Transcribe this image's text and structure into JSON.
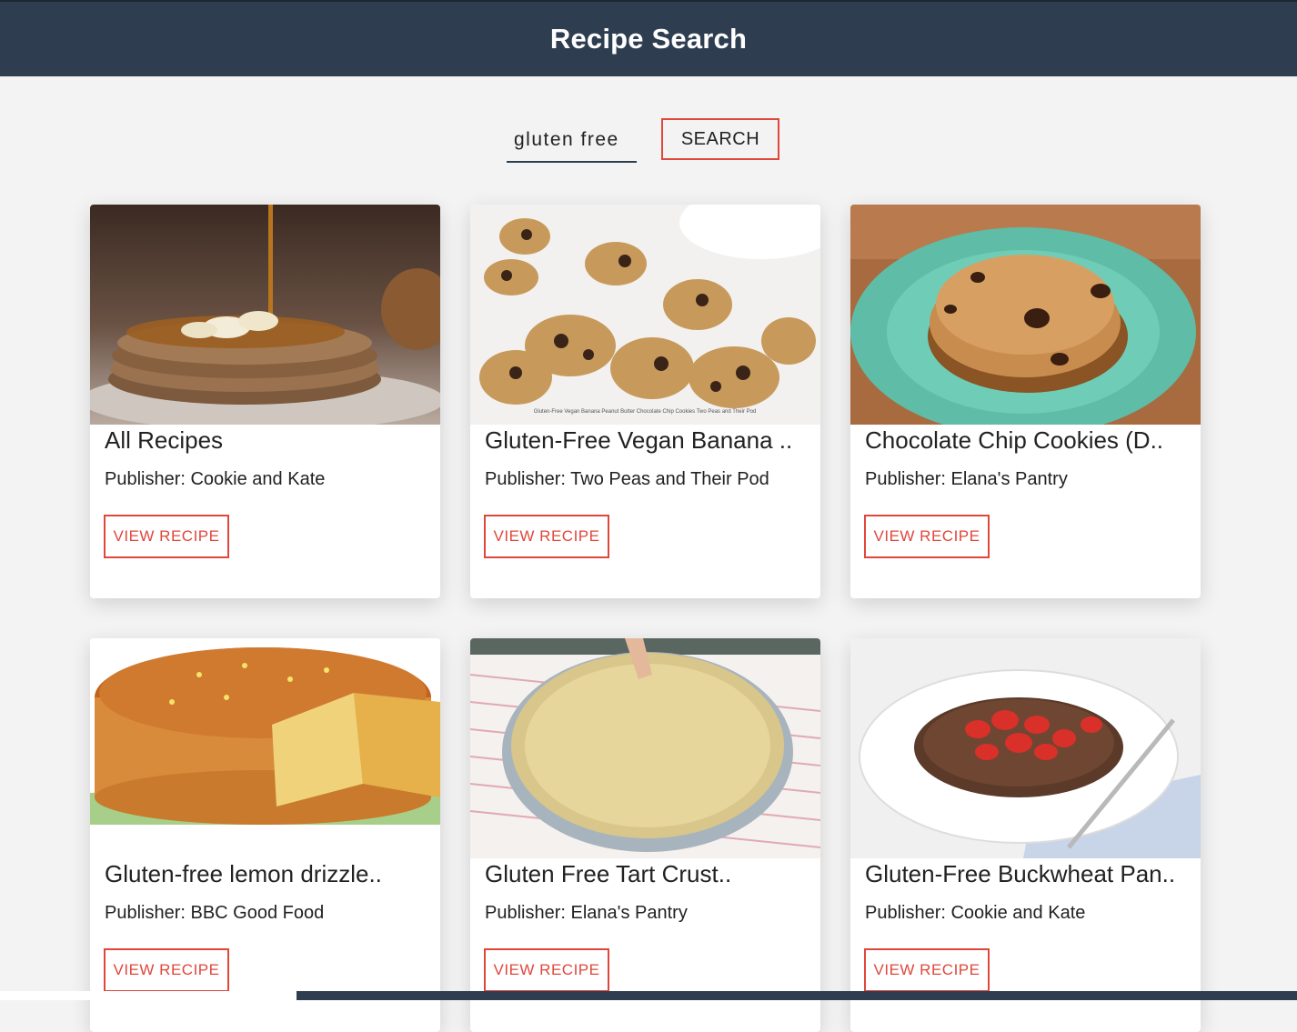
{
  "header": {
    "title": "Recipe Search"
  },
  "search": {
    "value": "gluten free",
    "button_label": "SEARCH"
  },
  "recipes": [
    {
      "title": "All Recipes",
      "publisher": "Publisher: Cookie and Kate",
      "button_label": "VIEW RECIPE",
      "image": "pancakes-with-banana-and-syrup"
    },
    {
      "title": "Gluten-Free Vegan Banana ..",
      "publisher": "Publisher: Two Peas and Their Pod",
      "button_label": "VIEW RECIPE",
      "image": "banana-oat-cookies",
      "image_caption": "Gluten-Free Vegan Banana Peanut Butter Chocolate Chip Cookies Two Peas and Their Pod"
    },
    {
      "title": "Chocolate Chip Cookies (D..",
      "publisher": "Publisher: Elana's Pantry",
      "button_label": "VIEW RECIPE",
      "image": "cookies-on-teal-plate"
    },
    {
      "title": "Gluten-free lemon drizzle..",
      "publisher": "Publisher: BBC Good Food",
      "button_label": "VIEW RECIPE",
      "image": "lemon-drizzle-cake"
    },
    {
      "title": "Gluten Free Tart Crust..",
      "publisher": "Publisher: Elana's Pantry",
      "button_label": "VIEW RECIPE",
      "image": "tart-crust-in-pan"
    },
    {
      "title": "Gluten-Free Buckwheat Pan..",
      "publisher": "Publisher: Cookie and Kate",
      "button_label": "VIEW RECIPE",
      "image": "buckwheat-pancake-with-strawberries"
    }
  ],
  "colors": {
    "header_bg": "#2e3e50",
    "accent": "#e0473b",
    "page_bg": "#f3f3f3"
  }
}
